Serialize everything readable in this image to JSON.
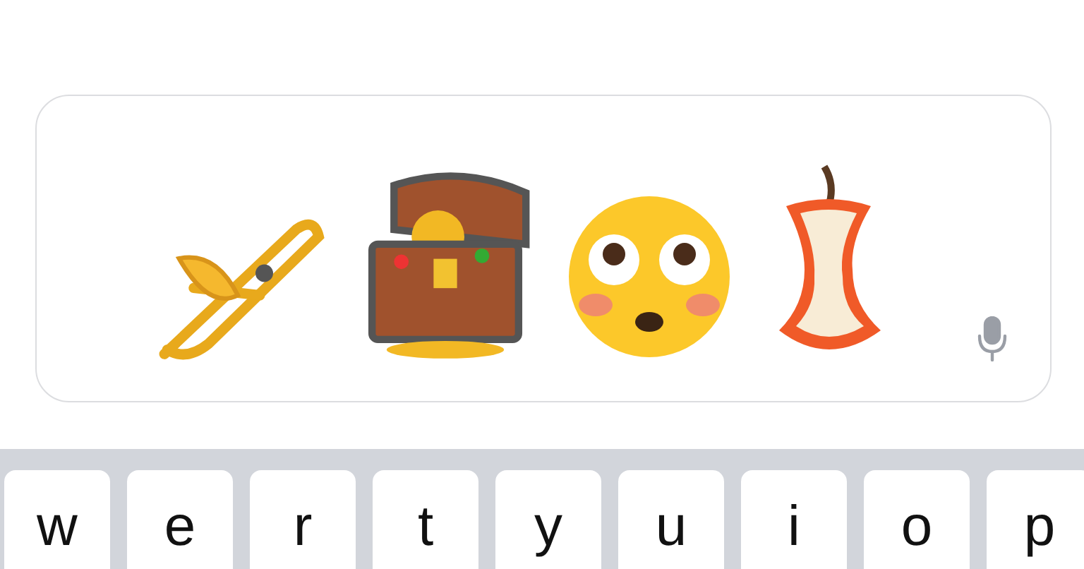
{
  "keyboard": {
    "keys": [
      "w",
      "e",
      "r",
      "t",
      "y",
      "u",
      "i",
      "o",
      "p"
    ]
  }
}
